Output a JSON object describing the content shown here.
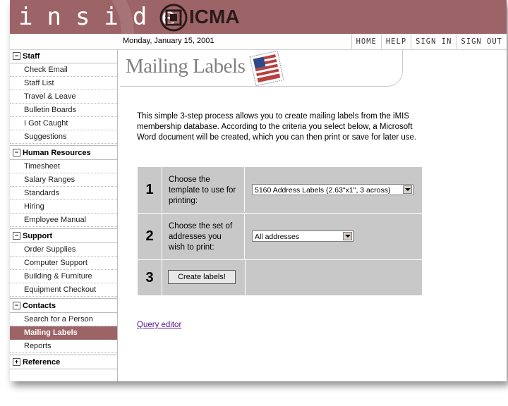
{
  "header": {
    "brand_inside": "inside",
    "brand_org": "ICMA"
  },
  "topbar": {
    "date": "Monday, January 15, 2001",
    "nav": [
      {
        "label": "HOME"
      },
      {
        "label": "HELP"
      },
      {
        "label": "SIGN IN"
      },
      {
        "label": "SIGN OUT"
      }
    ]
  },
  "sidebar": {
    "sections": [
      {
        "label": "Staff",
        "toggle": "−",
        "items": [
          "Check Email",
          "Staff List",
          "Travel & Leave",
          "Bulletin Boards",
          "I Got Caught",
          "Suggestions"
        ]
      },
      {
        "label": "Human Resources",
        "toggle": "−",
        "items": [
          "Timesheet",
          "Salary Ranges",
          "Standards",
          "Hiring",
          "Employee Manual"
        ]
      },
      {
        "label": "Support",
        "toggle": "−",
        "items": [
          "Order Supplies",
          "Computer Support",
          "Building & Furniture",
          "Equipment Checkout"
        ]
      },
      {
        "label": "Contacts",
        "toggle": "−",
        "items": [
          "Search for a Person",
          "Mailing Labels",
          "Reports"
        ]
      },
      {
        "label": "Reference",
        "toggle": "+",
        "items": []
      }
    ],
    "active_item": "Mailing Labels"
  },
  "main": {
    "title": "Mailing Labels",
    "intro": "This simple 3-step process allows you to create mailing labels from the iMIS membership database. According to the criteria you select below, a Microsoft Word document will be created, which you can then print or save for later use.",
    "steps": [
      {
        "num": "1",
        "text": "Choose the template to use for printing:",
        "select_value": "5160 Address Labels (2.63\"x1\", 3 across)"
      },
      {
        "num": "2",
        "text": "Choose the set of addresses you wish to print:",
        "select_value": "All addresses"
      },
      {
        "num": "3",
        "button_label": "Create labels!"
      }
    ],
    "query_link": "Query editor"
  },
  "colors": {
    "header_bg": "#9c6467",
    "active_bg": "#9c6467",
    "steps_bg": "#c8c8c8",
    "link": "#551a8b"
  }
}
